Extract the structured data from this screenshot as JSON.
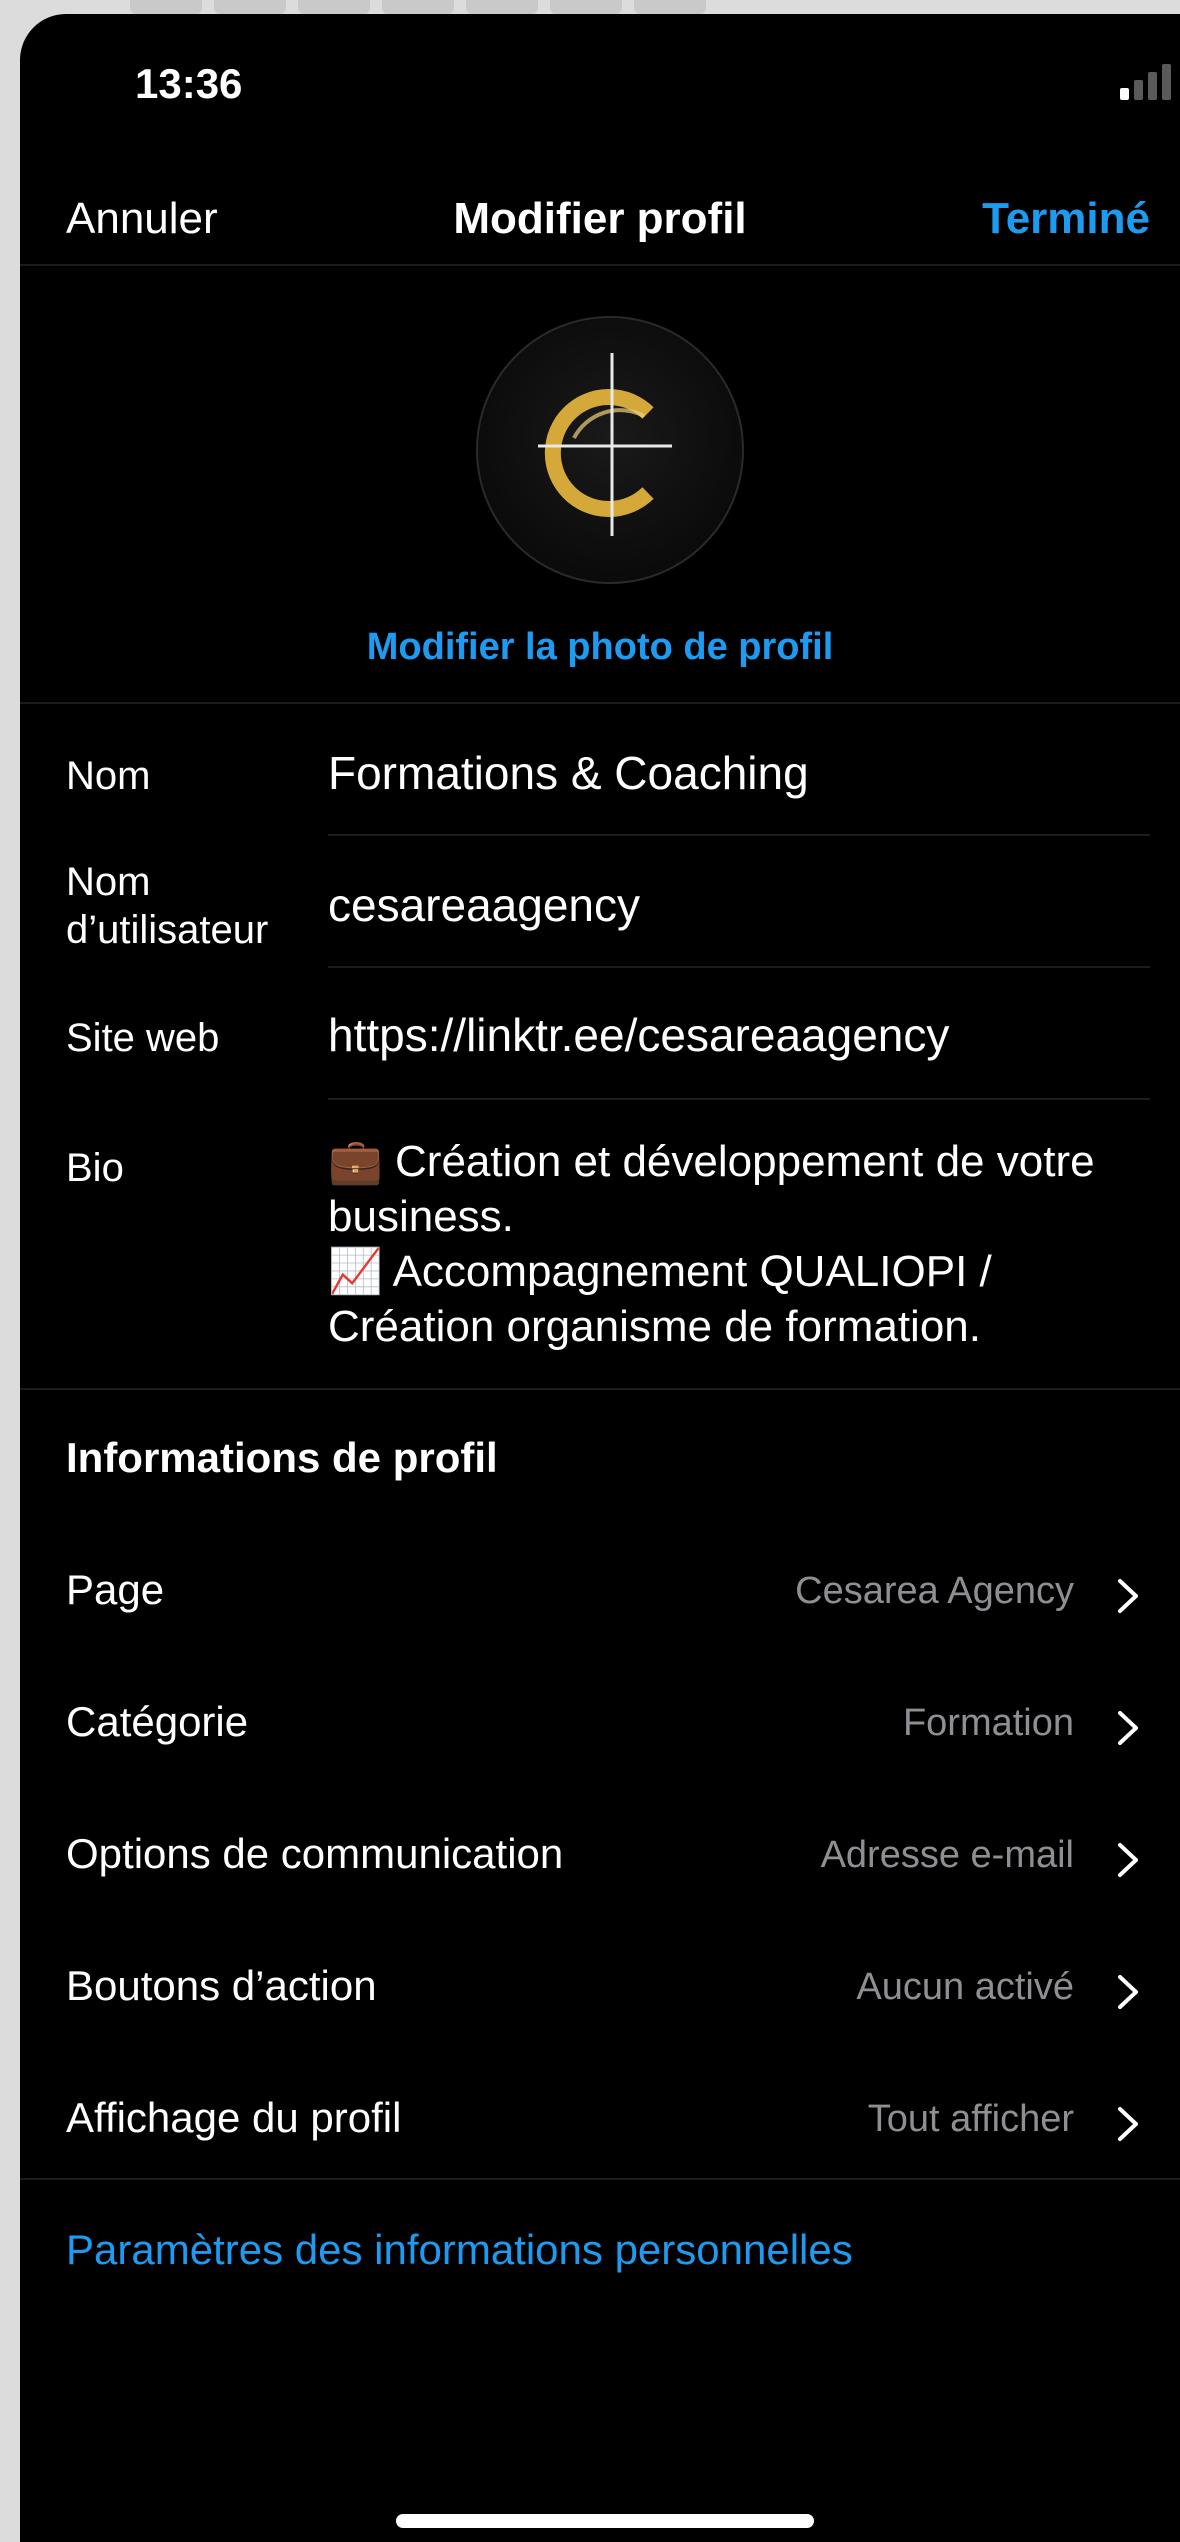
{
  "status_bar": {
    "time": "13:36"
  },
  "nav": {
    "cancel_label": "Annuler",
    "title": "Modifier profil",
    "done_label": "Terminé"
  },
  "avatar": {
    "change_photo_label": "Modifier la photo de profil"
  },
  "fields": {
    "name": {
      "label": "Nom",
      "value": "Formations & Coaching"
    },
    "username": {
      "label_line1": "Nom",
      "label_line2": "d’utilisateur",
      "value": "cesareaagency"
    },
    "website": {
      "label": "Site web",
      "value": "https://linktr.ee/cesareaagency"
    },
    "bio": {
      "label": "Bio",
      "line1": "💼 Création et développement de votre",
      "line2": "business.",
      "line3": "📈  Accompagnement QUALIOPI /",
      "line4": "Création organisme de formation."
    }
  },
  "profile_info": {
    "title": "Informations de profil",
    "rows": [
      {
        "label": "Page",
        "value": "Cesarea Agency",
        "icon": "chevron-right-icon"
      },
      {
        "label": "Catégorie",
        "value": "Formation",
        "icon": "chevron-right-icon"
      },
      {
        "label": "Options de communication",
        "value": "Adresse e-mail",
        "icon": "chevron-right-icon"
      },
      {
        "label": "Boutons d’action",
        "value": "Aucun activé",
        "icon": "chevron-right-icon"
      },
      {
        "label": "Affichage du profil",
        "value": "Tout afficher",
        "icon": "chevron-right-icon"
      }
    ]
  },
  "personal_settings_link": "Paramètres des informations personnelles",
  "colors": {
    "accent": "#1d9bf0",
    "background": "#000000",
    "secondary_text": "#8e8e93",
    "logo_gold": "#d4a93a"
  }
}
